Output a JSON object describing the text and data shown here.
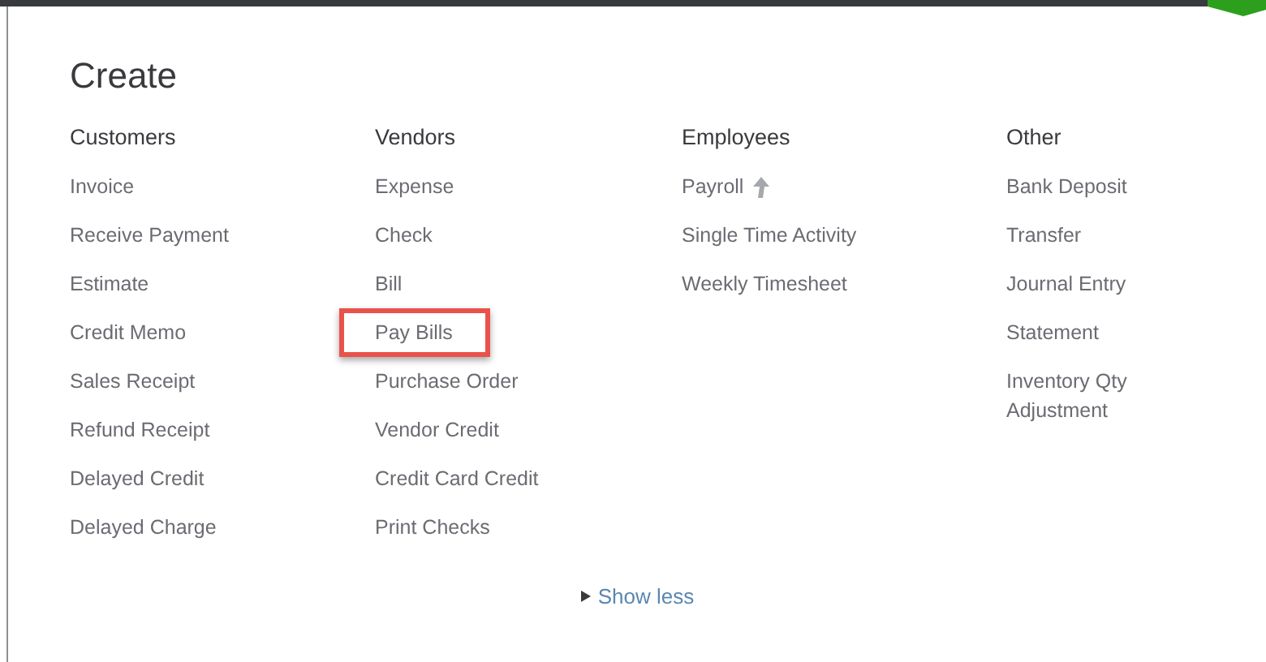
{
  "title": "Create",
  "columns": [
    {
      "heading": "Customers",
      "items": [
        {
          "label": "Invoice",
          "highlighted": false,
          "upgrade": false
        },
        {
          "label": "Receive Payment",
          "highlighted": false,
          "upgrade": false
        },
        {
          "label": "Estimate",
          "highlighted": false,
          "upgrade": false
        },
        {
          "label": "Credit Memo",
          "highlighted": false,
          "upgrade": false
        },
        {
          "label": "Sales Receipt",
          "highlighted": false,
          "upgrade": false
        },
        {
          "label": "Refund Receipt",
          "highlighted": false,
          "upgrade": false
        },
        {
          "label": "Delayed Credit",
          "highlighted": false,
          "upgrade": false
        },
        {
          "label": "Delayed Charge",
          "highlighted": false,
          "upgrade": false
        }
      ]
    },
    {
      "heading": "Vendors",
      "items": [
        {
          "label": "Expense",
          "highlighted": false,
          "upgrade": false
        },
        {
          "label": "Check",
          "highlighted": false,
          "upgrade": false
        },
        {
          "label": "Bill",
          "highlighted": false,
          "upgrade": false
        },
        {
          "label": "Pay Bills",
          "highlighted": true,
          "upgrade": false
        },
        {
          "label": "Purchase Order",
          "highlighted": false,
          "upgrade": false
        },
        {
          "label": "Vendor Credit",
          "highlighted": false,
          "upgrade": false
        },
        {
          "label": "Credit Card Credit",
          "highlighted": false,
          "upgrade": false
        },
        {
          "label": "Print Checks",
          "highlighted": false,
          "upgrade": false
        }
      ]
    },
    {
      "heading": "Employees",
      "items": [
        {
          "label": "Payroll",
          "highlighted": false,
          "upgrade": true
        },
        {
          "label": "Single Time Activity",
          "highlighted": false,
          "upgrade": false
        },
        {
          "label": "Weekly Timesheet",
          "highlighted": false,
          "upgrade": false
        }
      ]
    },
    {
      "heading": "Other",
      "items": [
        {
          "label": "Bank Deposit",
          "highlighted": false,
          "upgrade": false
        },
        {
          "label": "Transfer",
          "highlighted": false,
          "upgrade": false
        },
        {
          "label": "Journal Entry",
          "highlighted": false,
          "upgrade": false
        },
        {
          "label": "Statement",
          "highlighted": false,
          "upgrade": false
        },
        {
          "label": "Inventory Qty Adjustment",
          "highlighted": false,
          "upgrade": false
        }
      ]
    }
  ],
  "toggle": {
    "label": "Show less"
  }
}
